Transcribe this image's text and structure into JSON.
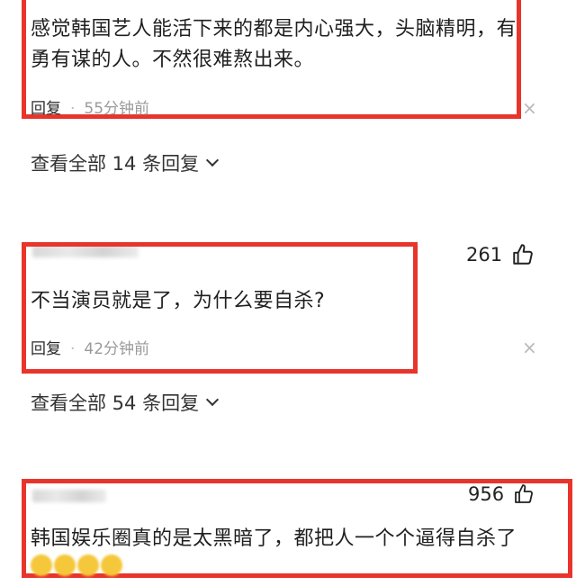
{
  "comments": [
    {
      "text": "感觉韩国艺人能活下来的都是内心强大，头脑精明，有勇有谋的人。不然很难熬出来。",
      "reply_label": "回复",
      "time": "55分钟前",
      "view_all": "查看全部 14 条回复",
      "close": "×"
    },
    {
      "likes": "261",
      "text": "不当演员就是了，为什么要自杀?",
      "reply_label": "回复",
      "time": "42分钟前",
      "view_all": "查看全部 54 条回复",
      "close": "×"
    },
    {
      "likes": "956",
      "text": "韩国娱乐圈真的是太黑暗了，都把人一个个逼得自杀了"
    }
  ],
  "icons": {
    "like": "thumb-up-icon",
    "close": "close-icon",
    "expand": "chevron-down-icon"
  },
  "colors": {
    "highlight": "#e8352c",
    "time": "#9a9a9a"
  }
}
